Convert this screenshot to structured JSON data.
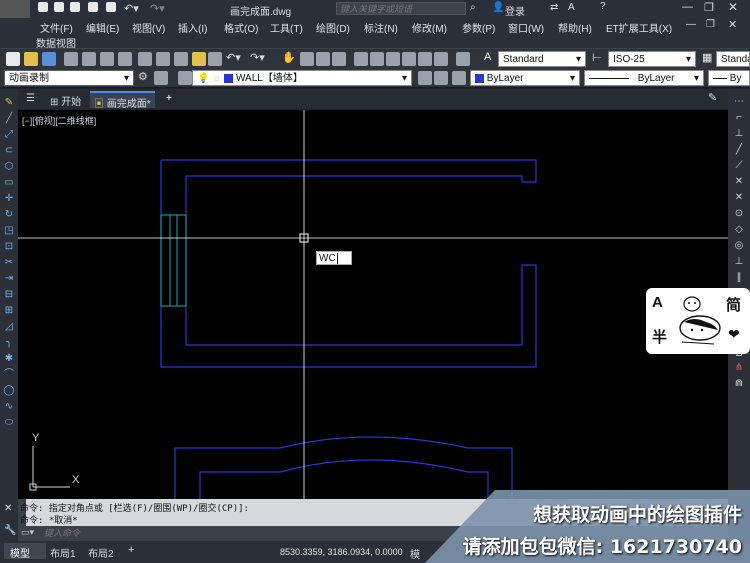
{
  "title_bar": {
    "file_name": "画完成面.dwg",
    "search_placeholder": "键入关键字或短语",
    "login": "登录"
  },
  "menu": [
    "文件(F)",
    "编辑(E)",
    "视图(V)",
    "插入(I)",
    "格式(O)",
    "工具(T)",
    "绘图(D)",
    "标注(N)",
    "修改(M)",
    "参数(P)",
    "窗口(W)",
    "帮助(H)",
    "ET扩展工具(X)"
  ],
  "submenu": "数据视图",
  "toolbar1": {
    "text_style": "Standard",
    "dim_style": "ISO-25",
    "table_style": "Standa"
  },
  "toolbar2": {
    "workspace": "动画录制",
    "layer": "WALL【墙体】",
    "color": "ByLayer",
    "linetype": "ByLayer",
    "lineweight": "By"
  },
  "tabs": {
    "start": "开始",
    "drawing": "画完成面*",
    "add": "+"
  },
  "viewport_label": "[−][俯视][二维线框]",
  "cursor_input": "WC",
  "ucs": {
    "x": "X",
    "y": "Y"
  },
  "command": {
    "line1": "命令: 指定对角点或 [栏选(F)/圈围(WP)/圈交(CP)]:",
    "line2": "命令: *取消*",
    "placeholder": "键入命令"
  },
  "status": {
    "model_tab": "模型",
    "layout1": "布局1",
    "layout2": "布局2",
    "add": "+",
    "coords": "8530.3359, 3186.0934, 0.0000",
    "mode": "模"
  },
  "promo": {
    "line1": "想获取动画中的绘图插件",
    "line2": "请添加包包微信: 1621730740"
  },
  "sticker": {
    "top_left": "A",
    "top_right": "简",
    "bottom_left": "半"
  },
  "colors": {
    "wall_line": "#2a35d6",
    "cyan_line": "#1aa8a8",
    "crosshair": "#ffffff",
    "canvas_bg": "#000000"
  }
}
